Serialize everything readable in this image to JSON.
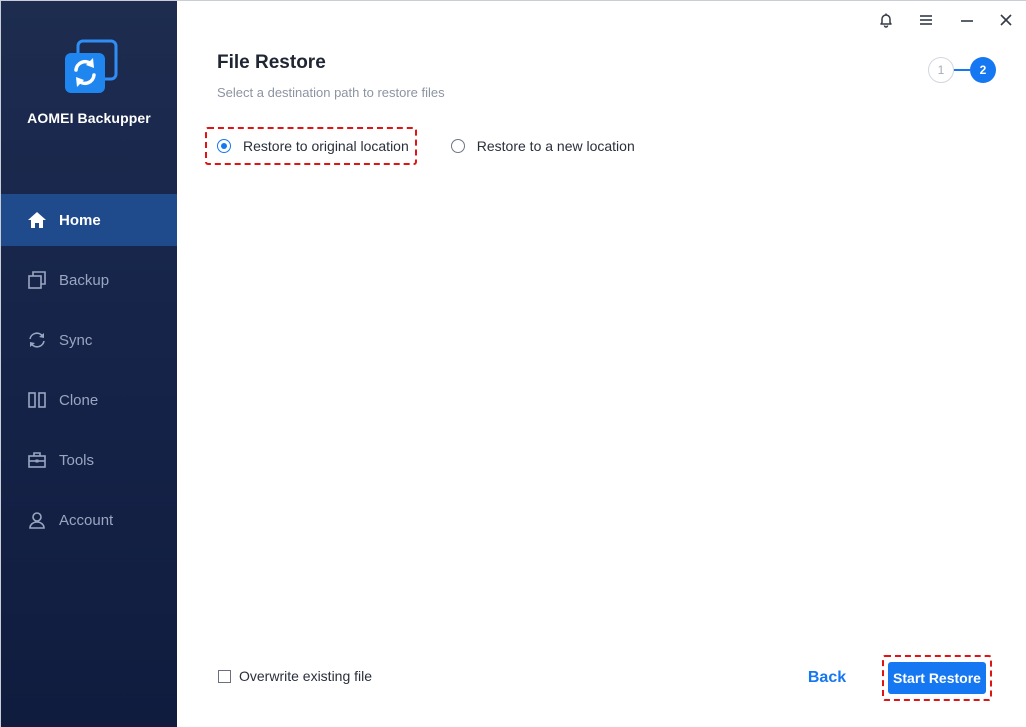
{
  "app": {
    "name": "AOMEI Backupper"
  },
  "sidebar": {
    "items": [
      {
        "label": "Home",
        "icon": "home-icon",
        "active": true
      },
      {
        "label": "Backup",
        "icon": "backup-icon",
        "active": false
      },
      {
        "label": "Sync",
        "icon": "sync-icon",
        "active": false
      },
      {
        "label": "Clone",
        "icon": "clone-icon",
        "active": false
      },
      {
        "label": "Tools",
        "icon": "tools-icon",
        "active": false
      },
      {
        "label": "Account",
        "icon": "account-icon",
        "active": false
      }
    ]
  },
  "titlebar": {
    "icons": [
      "bell-icon",
      "menu-icon",
      "minimize-icon",
      "close-icon"
    ]
  },
  "page": {
    "title": "File Restore",
    "subtitle": "Select a destination path to restore files"
  },
  "steps": {
    "step1": "1",
    "step2": "2",
    "current": 2
  },
  "options": {
    "original": {
      "label": "Restore to original location",
      "checked": true
    },
    "new_location": {
      "label": "Restore to a new location",
      "checked": false
    }
  },
  "overwrite": {
    "label": "Overwrite existing file",
    "checked": false
  },
  "footer": {
    "back_label": "Back",
    "start_label": "Start Restore"
  },
  "colors": {
    "accent": "#1677f2",
    "sidebar_bg": "#16244a",
    "sidebar_active": "#1f4a8c",
    "highlight": "#e01414"
  }
}
